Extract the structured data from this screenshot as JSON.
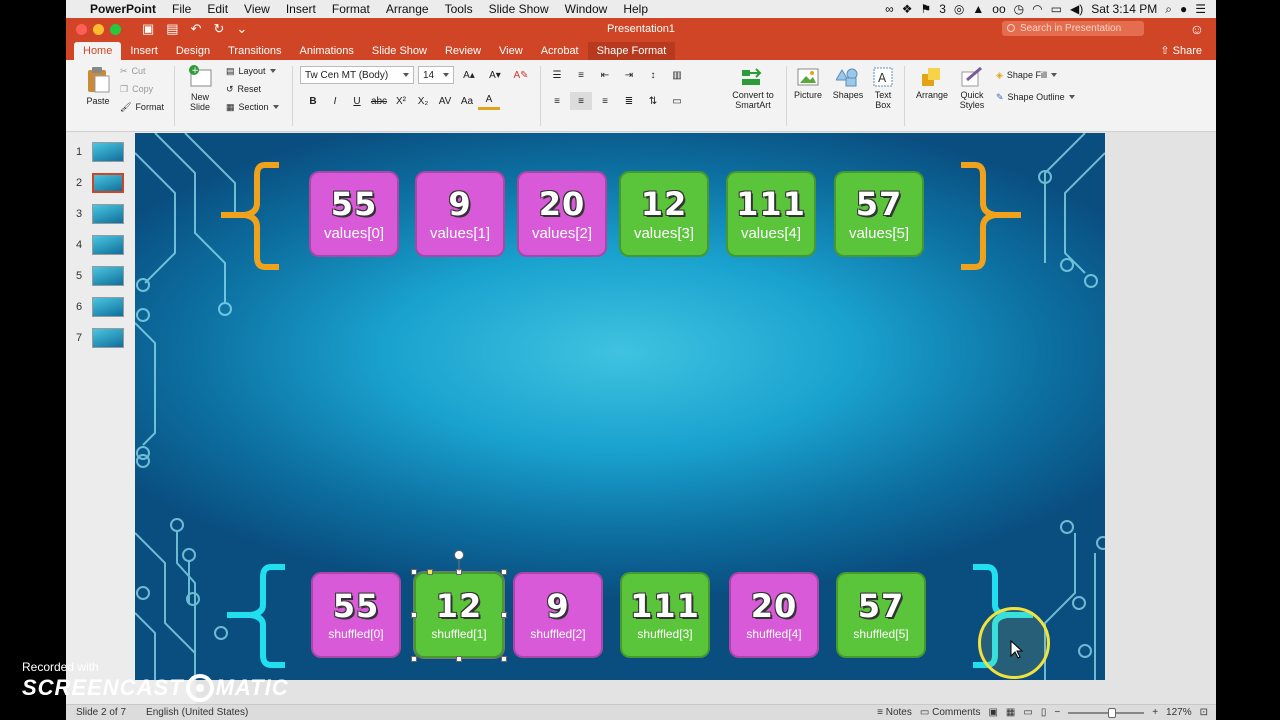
{
  "menubar": {
    "app_name": "PowerPoint",
    "items": [
      "File",
      "Edit",
      "View",
      "Insert",
      "Format",
      "Arrange",
      "Tools",
      "Slide Show",
      "Window",
      "Help"
    ],
    "battery_badge": "3",
    "clock": "Sat 3:14 PM"
  },
  "window": {
    "title": "Presentation1",
    "search_placeholder": "Search in Presentation",
    "share_label": "Share",
    "traffic_colors": [
      "#fd5f57",
      "#febd2e",
      "#27c840"
    ]
  },
  "tabs": [
    "Home",
    "Insert",
    "Design",
    "Transitions",
    "Animations",
    "Slide Show",
    "Review",
    "View",
    "Acrobat",
    "Shape Format"
  ],
  "active_tab": "Home",
  "ribbon": {
    "paste": "Paste",
    "cut": "Cut",
    "copy": "Copy",
    "format": "Format",
    "new_slide": [
      "New",
      "Slide"
    ],
    "layout": "Layout",
    "reset": "Reset",
    "section": "Section",
    "font_name": "Tw Cen MT (Body)",
    "font_size": "14",
    "convert_smartart": [
      "Convert to",
      "SmartArt"
    ],
    "picture": "Picture",
    "shapes": "Shapes",
    "text_box": [
      "Text",
      "Box"
    ],
    "arrange": "Arrange",
    "quick_styles": [
      "Quick",
      "Styles"
    ],
    "shape_fill": "Shape Fill",
    "shape_outline": "Shape Outline"
  },
  "thumbnails": [
    "1",
    "2",
    "3",
    "4",
    "5",
    "6",
    "7"
  ],
  "selected_slide": 2,
  "slide": {
    "top_row": [
      {
        "value": "55",
        "label": "values[0]",
        "color": "magenta"
      },
      {
        "value": "9",
        "label": "values[1]",
        "color": "magenta"
      },
      {
        "value": "20",
        "label": "values[2]",
        "color": "magenta"
      },
      {
        "value": "12",
        "label": "values[3]",
        "color": "green"
      },
      {
        "value": "111",
        "label": "values[4]",
        "color": "green"
      },
      {
        "value": "57",
        "label": "values[5]",
        "color": "green"
      }
    ],
    "bottom_row": [
      {
        "value": "55",
        "label": "shuffled[0]",
        "color": "magenta"
      },
      {
        "value": "12",
        "label": "shuffled[1]",
        "color": "green"
      },
      {
        "value": "9",
        "label": "shuffled[2]",
        "color": "magenta"
      },
      {
        "value": "111",
        "label": "shuffled[3]",
        "color": "green"
      },
      {
        "value": "20",
        "label": "shuffled[4]",
        "color": "magenta"
      },
      {
        "value": "57",
        "label": "shuffled[5]",
        "color": "green"
      }
    ],
    "bracket_top_color": "#f0a21c",
    "bracket_bottom_color": "#20e0f0"
  },
  "status": {
    "slide_pos": "Slide 2 of 7",
    "language": "English (United States)",
    "notes": "Notes",
    "comments": "Comments",
    "zoom": "127%"
  },
  "watermark": {
    "recorded_with": "Recorded with",
    "brand_left": "SCREENCAST",
    "brand_right": "MATIC"
  }
}
